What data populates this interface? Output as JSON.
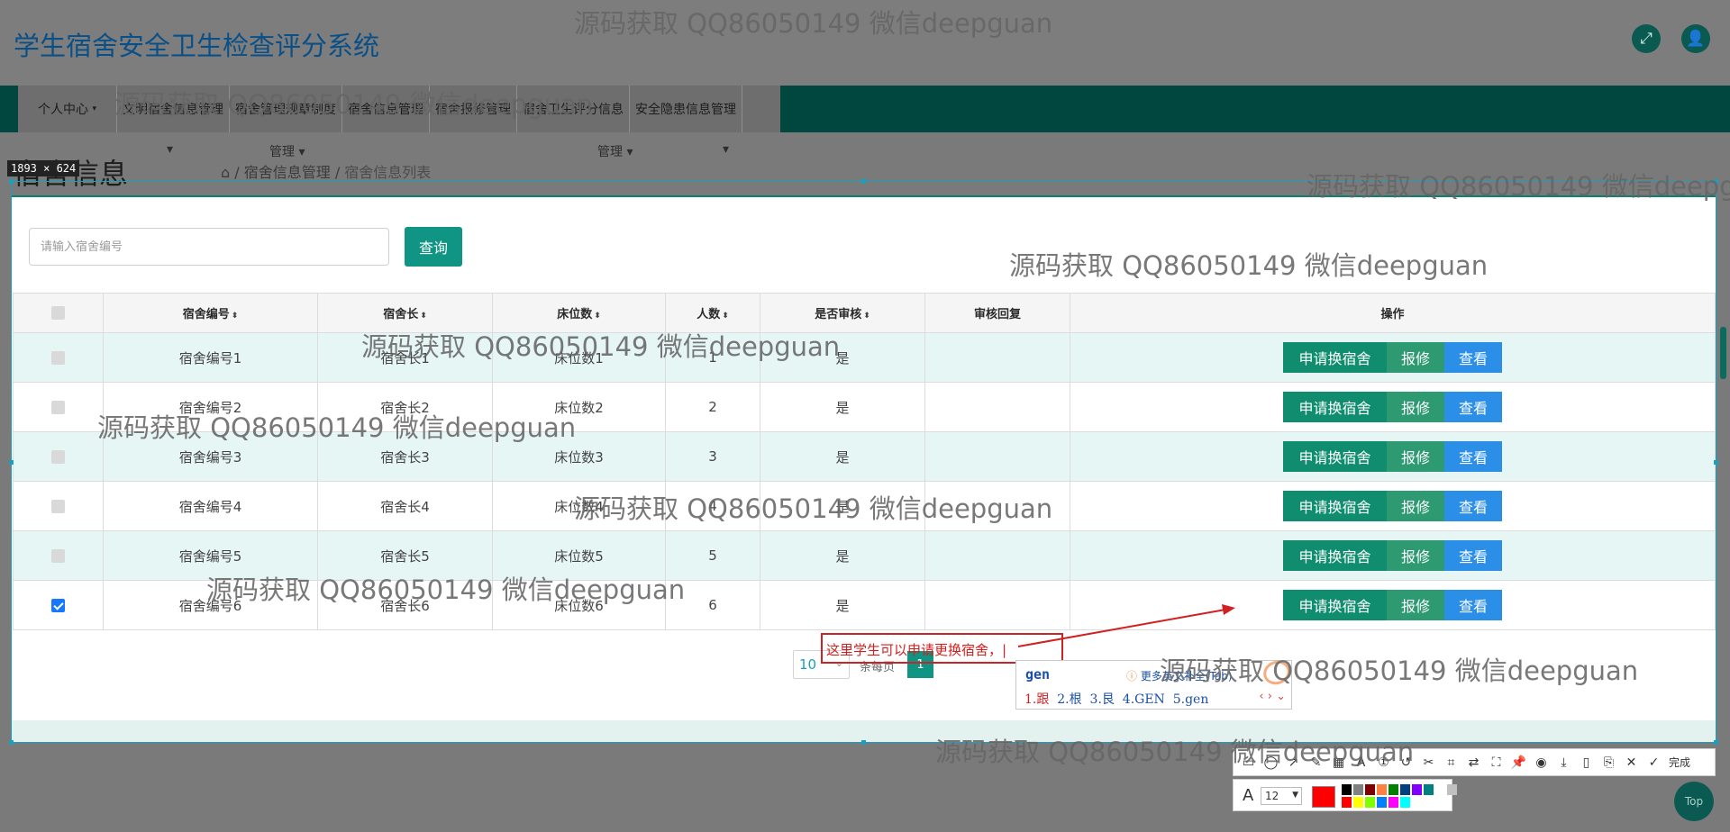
{
  "app": {
    "title": "学生宿舍安全卫生检查评分系统"
  },
  "header": {
    "fullscreen_icon": "expand-icon",
    "user_icon": "user-icon"
  },
  "nav": {
    "items": [
      {
        "label": "个人中心"
      },
      {
        "label": "文明宿舍信息管理"
      },
      {
        "label": "宿舍管理规章制度"
      },
      {
        "label": "宿舍信息管理"
      },
      {
        "label": "宿舍报修管理"
      },
      {
        "label": "宿舍卫生评分信息"
      },
      {
        "label": "安全隐患信息管理"
      }
    ],
    "sub_left": "管理",
    "sub_right": "管理"
  },
  "page": {
    "heading": "宿舍信息",
    "breadcrumb": [
      "宿舍信息管理",
      "宿舍信息列表"
    ]
  },
  "screenshot_overlay": {
    "size_label": "1893 × 624"
  },
  "search": {
    "placeholder": "请输入宿舍编号",
    "button": "查询"
  },
  "table": {
    "headers": [
      "宿舍编号",
      "宿舍长",
      "床位数",
      "人数",
      "是否审核",
      "审核回复",
      "操作"
    ],
    "rows": [
      {
        "no": "宿舍编号1",
        "leader": "宿舍长1",
        "beds": "床位数1",
        "count": "1",
        "audit": "是",
        "reply": "",
        "checked": false
      },
      {
        "no": "宿舍编号2",
        "leader": "宿舍长2",
        "beds": "床位数2",
        "count": "2",
        "audit": "是",
        "reply": "",
        "checked": false
      },
      {
        "no": "宿舍编号3",
        "leader": "宿舍长3",
        "beds": "床位数3",
        "count": "3",
        "audit": "是",
        "reply": "",
        "checked": false
      },
      {
        "no": "宿舍编号4",
        "leader": "宿舍长4",
        "beds": "床位数4",
        "count": "4",
        "audit": "是",
        "reply": "",
        "checked": false
      },
      {
        "no": "宿舍编号5",
        "leader": "宿舍长5",
        "beds": "床位数5",
        "count": "5",
        "audit": "是",
        "reply": "",
        "checked": false
      },
      {
        "no": "宿舍编号6",
        "leader": "宿舍长6",
        "beds": "床位数6",
        "count": "6",
        "audit": "是",
        "reply": "",
        "checked": true
      }
    ],
    "actions": {
      "change": "申请换宿舍",
      "repair": "报修",
      "view": "查看"
    }
  },
  "pagination": {
    "page_size": "10",
    "per_page_label": "条每页",
    "current_page": "1"
  },
  "annotation": {
    "text": "这里学生可以申请更换宿舍，"
  },
  "ime": {
    "typed": "gen",
    "hint": "更多英文补全(Tab)",
    "candidates": [
      "1.跟",
      "2.根",
      "3.艮",
      "4.GEN",
      "5.gen"
    ]
  },
  "screenshot_toolbar": {
    "done_label": "完成",
    "font_size": "12",
    "current_color": "#ff0000",
    "swatches": [
      "#000000",
      "#808080",
      "#800000",
      "#ff8040",
      "#008000",
      "#004080",
      "#8000ff",
      "#008080",
      "#ffffff",
      "#c0c0c0",
      "#ff0000",
      "#ffff00",
      "#80ff00",
      "#0080ff",
      "#ff00ff",
      "#00ffff"
    ]
  },
  "top_button": "Top",
  "watermark": "源码获取 QQ86050149 微信deepguan"
}
